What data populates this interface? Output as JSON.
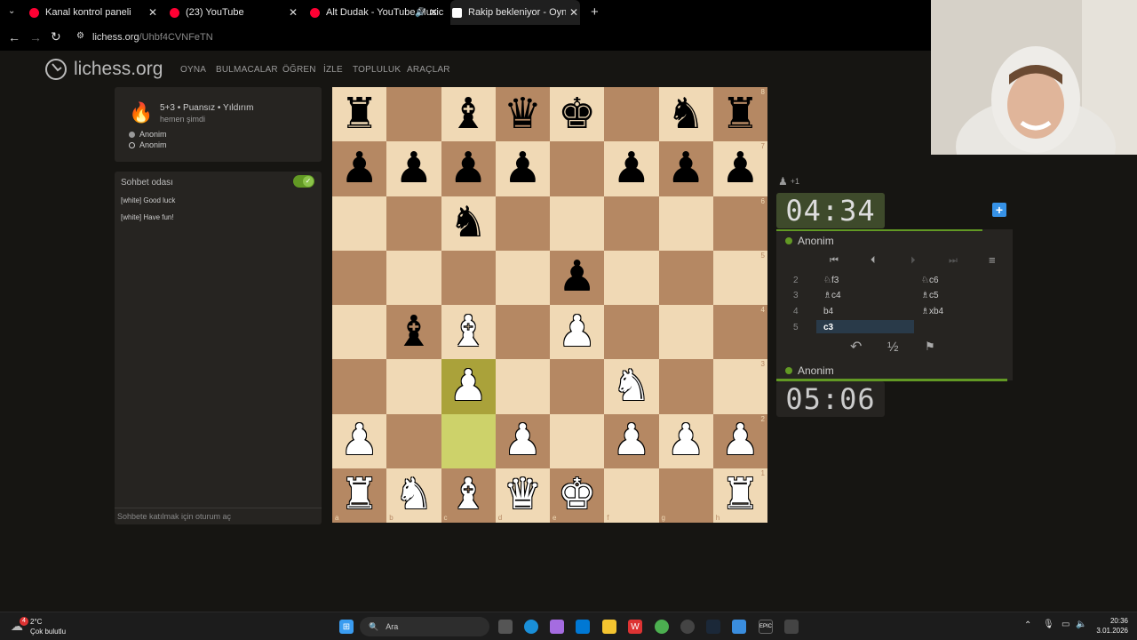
{
  "browser": {
    "tabs": [
      {
        "title": "Kanal kontrol paneli - YouTube",
        "icon": "youtube-icon",
        "color": "#ff0033"
      },
      {
        "title": "(23) YouTube",
        "icon": "youtube-icon",
        "color": "#ff0033"
      },
      {
        "title": "Alt Dudak - YouTube Music",
        "icon": "youtube-music-icon",
        "color": "#ff0033"
      },
      {
        "title": "Rakip bekleniyor - Oyna Anon...",
        "icon": "lichess-icon",
        "color": "#ffffff"
      }
    ],
    "url_host": "lichess.org",
    "url_path": "/Uhbf4CVNFeTN"
  },
  "site": {
    "logo_text": "lichess.org",
    "menu": [
      "OYNA",
      "BULMACALAR",
      "ÖĞREN",
      "İZLE",
      "TOPLULUK",
      "ARAÇLAR"
    ]
  },
  "game": {
    "mode": "5+3 • Puansız • Yıldırım",
    "time": "hemen şimdi",
    "players": [
      "Anonim",
      "Anonim"
    ]
  },
  "chat": {
    "title": "Sohbet odası",
    "messages": [
      {
        "author": "[white]",
        "text": "Good luck"
      },
      {
        "author": "[white]",
        "text": "Have fun!"
      }
    ],
    "input_placeholder": "Sohbete katılmak için oturum aç"
  },
  "board": {
    "ranks": [
      "8",
      "7",
      "6",
      "5",
      "4",
      "3",
      "2",
      "1"
    ],
    "files": [
      "a",
      "b",
      "c",
      "d",
      "e",
      "f",
      "g",
      "h"
    ],
    "position": [
      [
        "bR",
        "",
        "bB",
        "bQ",
        "bK",
        "",
        "bN",
        "bR"
      ],
      [
        "bP",
        "bP",
        "bP",
        "bP",
        "",
        "bP",
        "bP",
        "bP"
      ],
      [
        "",
        "",
        "bN",
        "",
        "",
        "",
        "",
        ""
      ],
      [
        "",
        "",
        "",
        "",
        "bP",
        "",
        "",
        ""
      ],
      [
        "",
        "bB",
        "wB",
        "",
        "wP",
        "",
        "",
        ""
      ],
      [
        "",
        "",
        "wP",
        "",
        "",
        "wN",
        "",
        ""
      ],
      [
        "wP",
        "",
        "",
        "wP",
        "",
        "wP",
        "wP",
        "wP"
      ],
      [
        "wR",
        "wN",
        "wB",
        "wQ",
        "wK",
        "",
        "",
        "wR"
      ]
    ],
    "last_move": [
      "c2",
      "c3"
    ]
  },
  "clocks": {
    "opponent_time": "04:34",
    "player_time": "05:06",
    "opponent_name": "Anonim",
    "player_name": "Anonim",
    "spectators": "+1"
  },
  "moves": [
    {
      "num": "2",
      "white": "♘f3",
      "black": "♘c6"
    },
    {
      "num": "3",
      "white": "♗c4",
      "black": "♗c5"
    },
    {
      "num": "4",
      "white": "b4",
      "black": "♗xb4"
    },
    {
      "num": "5",
      "white": "c3",
      "black": ""
    }
  ],
  "taskbar": {
    "weather_temp": "2°C",
    "weather_desc": "Çok bulutlu",
    "weather_badge": "4",
    "search_placeholder": "Ara",
    "time": "20:36",
    "date": "3.01.2026"
  }
}
